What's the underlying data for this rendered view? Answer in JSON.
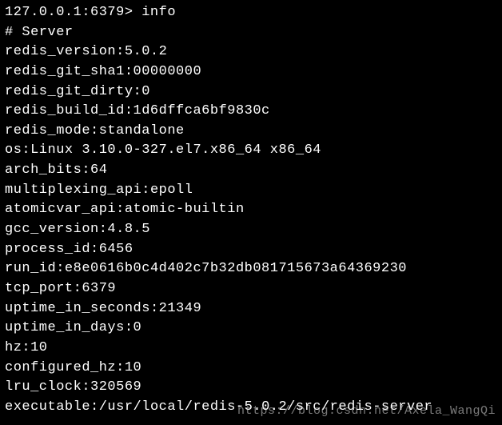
{
  "prompt": "127.0.0.1:6379> info",
  "section_header": "# Server",
  "info": {
    "redis_version": "5.0.2",
    "redis_git_sha1": "00000000",
    "redis_git_dirty": "0",
    "redis_build_id": "1d6dffca6bf9830c",
    "redis_mode": "standalone",
    "os": "Linux 3.10.0-327.el7.x86_64 x86_64",
    "arch_bits": "64",
    "multiplexing_api": "epoll",
    "atomicvar_api": "atomic-builtin",
    "gcc_version": "4.8.5",
    "process_id": "6456",
    "run_id": "e8e0616b0c4d402c7b32db081715673a64369230",
    "tcp_port": "6379",
    "uptime_in_seconds": "21349",
    "uptime_in_days": "0",
    "hz": "10",
    "configured_hz": "10",
    "lru_clock": "320569",
    "executable": "/usr/local/redis-5.0.2/src/redis-server"
  },
  "labels": {
    "redis_version": "redis_version",
    "redis_git_sha1": "redis_git_sha1",
    "redis_git_dirty": "redis_git_dirty",
    "redis_build_id": "redis_build_id",
    "redis_mode": "redis_mode",
    "os": "os",
    "arch_bits": "arch_bits",
    "multiplexing_api": "multiplexing_api",
    "atomicvar_api": "atomicvar_api",
    "gcc_version": "gcc_version",
    "process_id": "process_id",
    "run_id": "run_id",
    "tcp_port": "tcp_port",
    "uptime_in_seconds": "uptime_in_seconds",
    "uptime_in_days": "uptime_in_days",
    "hz": "hz",
    "configured_hz": "configured_hz",
    "lru_clock": "lru_clock",
    "executable": "executable"
  },
  "watermark": "https://blog.csdn.net/Axela_WangQi"
}
